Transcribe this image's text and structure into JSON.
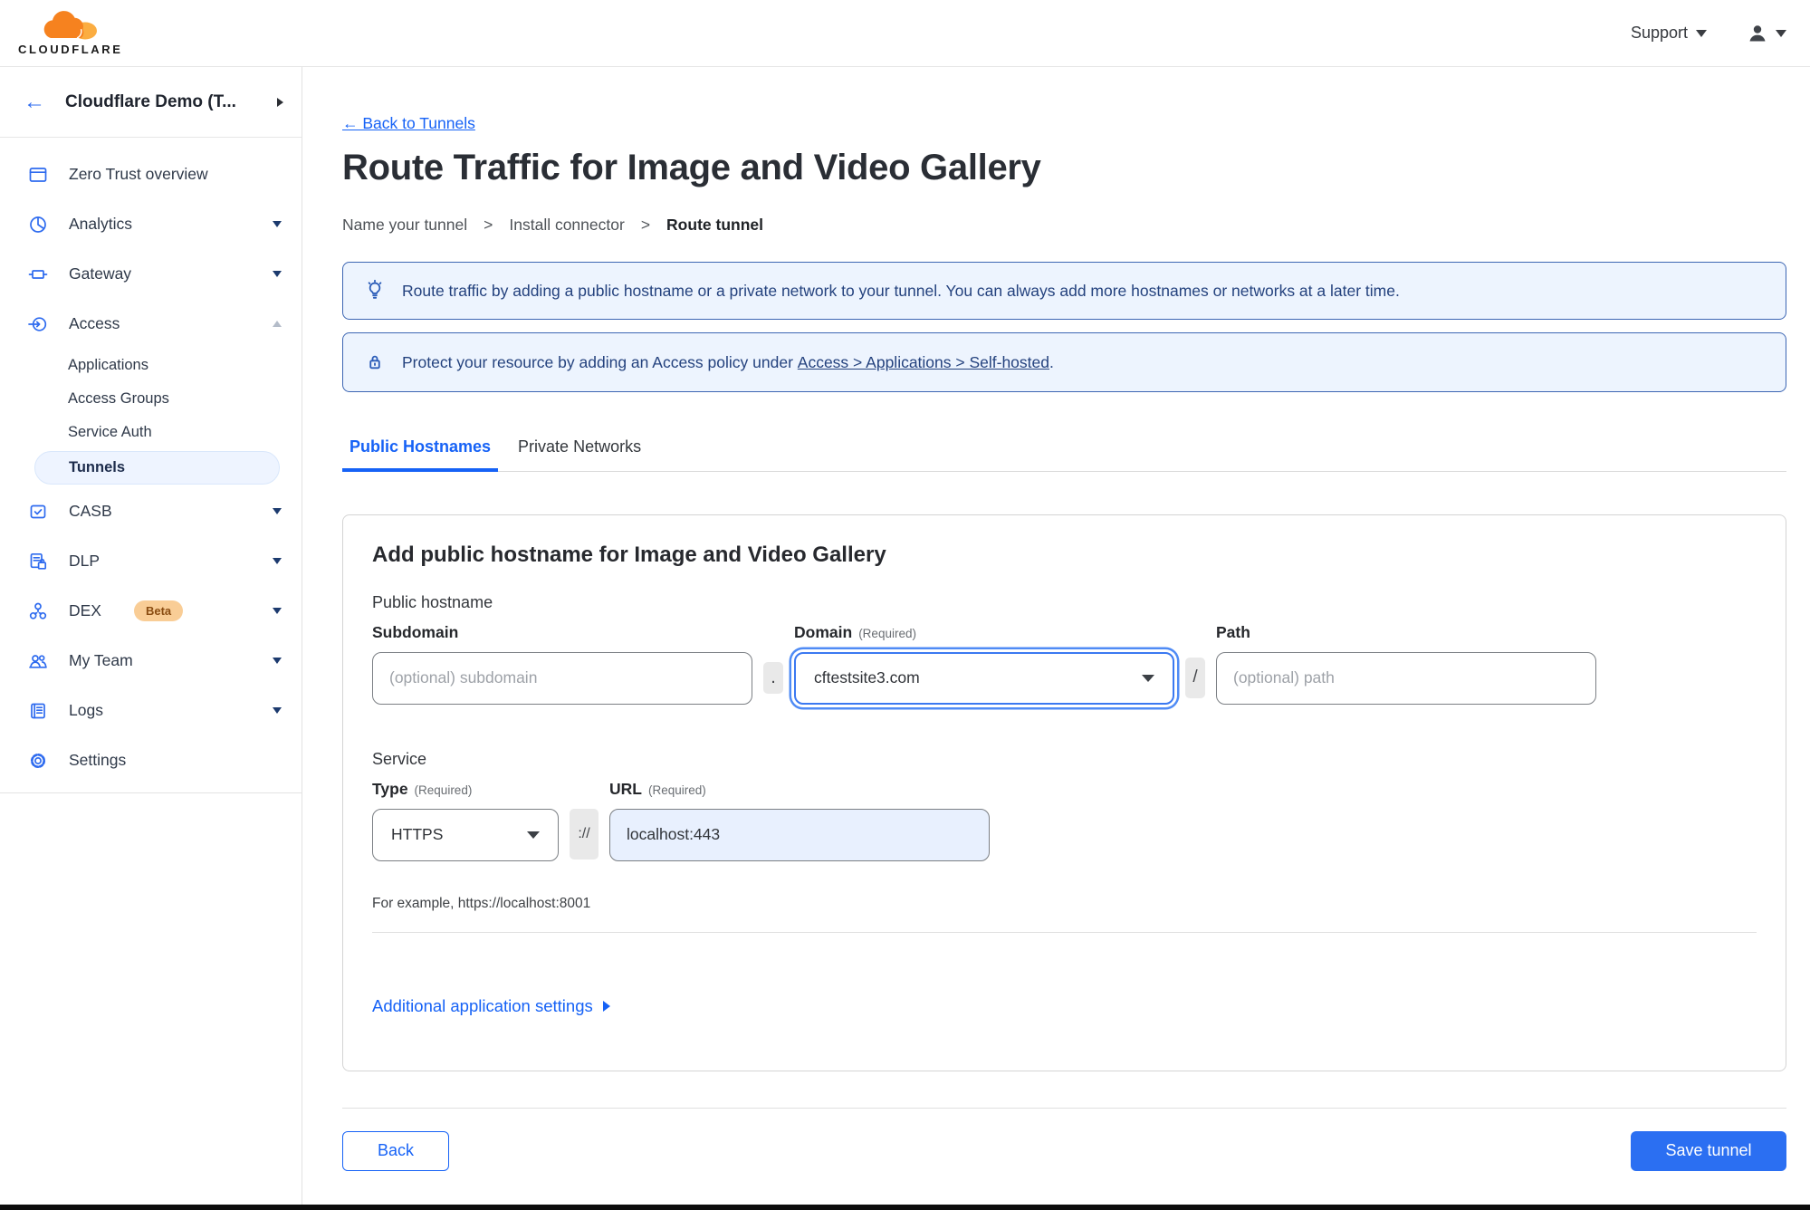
{
  "colors": {
    "accent_blue": "#1662f6",
    "save_button_blue": "#2b6ff2",
    "banner_bg": "#edf4fe",
    "banner_border": "#3d66b3",
    "banner_text": "#24427e",
    "active_pill_bg": "#eef4ff",
    "beta_badge_bg": "#f9cd96",
    "beta_badge_text": "#8a4c11",
    "url_input_bg": "#e8f0fe",
    "logo_orange": "#f6821f",
    "logo_light_orange": "#fbad41"
  },
  "topbar": {
    "brand": "CLOUDFLARE",
    "support_label": "Support"
  },
  "sidebar": {
    "account_name": "Cloudflare Demo (T...",
    "items": [
      {
        "label": "Zero Trust overview",
        "icon": "window-icon",
        "caret": "none"
      },
      {
        "label": "Analytics",
        "icon": "pie-chart-icon",
        "caret": "down"
      },
      {
        "label": "Gateway",
        "icon": "gateway-icon",
        "caret": "down"
      },
      {
        "label": "Access",
        "icon": "access-arrow-icon",
        "caret": "up"
      },
      {
        "label": "CASB",
        "icon": "casb-check-icon",
        "caret": "down"
      },
      {
        "label": "DLP",
        "icon": "document-lock-icon",
        "caret": "down",
        "badge": ""
      },
      {
        "label": "DEX",
        "icon": "dex-nodes-icon",
        "caret": "down",
        "badge": "Beta"
      },
      {
        "label": "My Team",
        "icon": "team-icon",
        "caret": "down"
      },
      {
        "label": "Logs",
        "icon": "logs-icon",
        "caret": "down"
      },
      {
        "label": "Settings",
        "icon": "gear-icon",
        "caret": "none"
      }
    ],
    "access_subitems": [
      {
        "label": "Applications"
      },
      {
        "label": "Access Groups"
      },
      {
        "label": "Service Auth"
      },
      {
        "label": "Tunnels",
        "active": true
      }
    ]
  },
  "page": {
    "back_link": "← Back to Tunnels",
    "title": "Route Traffic for Image and Video Gallery",
    "steps": [
      "Name your tunnel",
      "Install connector",
      "Route tunnel"
    ],
    "step_separator": ">",
    "banner_route": "Route traffic by adding a public hostname or a private network to your tunnel. You can always add more hostnames or networks at a later time.",
    "banner_protect_prefix": "Protect your resource by adding an Access policy under",
    "banner_protect_link": "Access > Applications > Self-hosted",
    "banner_protect_suffix": ".",
    "tabs": [
      "Public Hostnames",
      "Private Networks"
    ]
  },
  "form": {
    "heading": "Add public hostname for Image and Video Gallery",
    "public_hostname_label": "Public hostname",
    "subdomain_label": "Subdomain",
    "subdomain_placeholder": "(optional) subdomain",
    "dot_separator": ".",
    "domain_label": "Domain",
    "required_note": "(Required)",
    "domain_value": "cftestsite3.com",
    "slash_separator": "/",
    "path_label": "Path",
    "path_placeholder": "(optional) path",
    "service_label": "Service",
    "type_label": "Type",
    "type_value": "HTTPS",
    "scheme_separator": "://",
    "url_label": "URL",
    "url_value": "localhost:443",
    "url_example": "For example, https://localhost:8001",
    "additional_settings_label": "Additional application settings"
  },
  "footer": {
    "back_label": "Back",
    "save_label": "Save tunnel"
  }
}
